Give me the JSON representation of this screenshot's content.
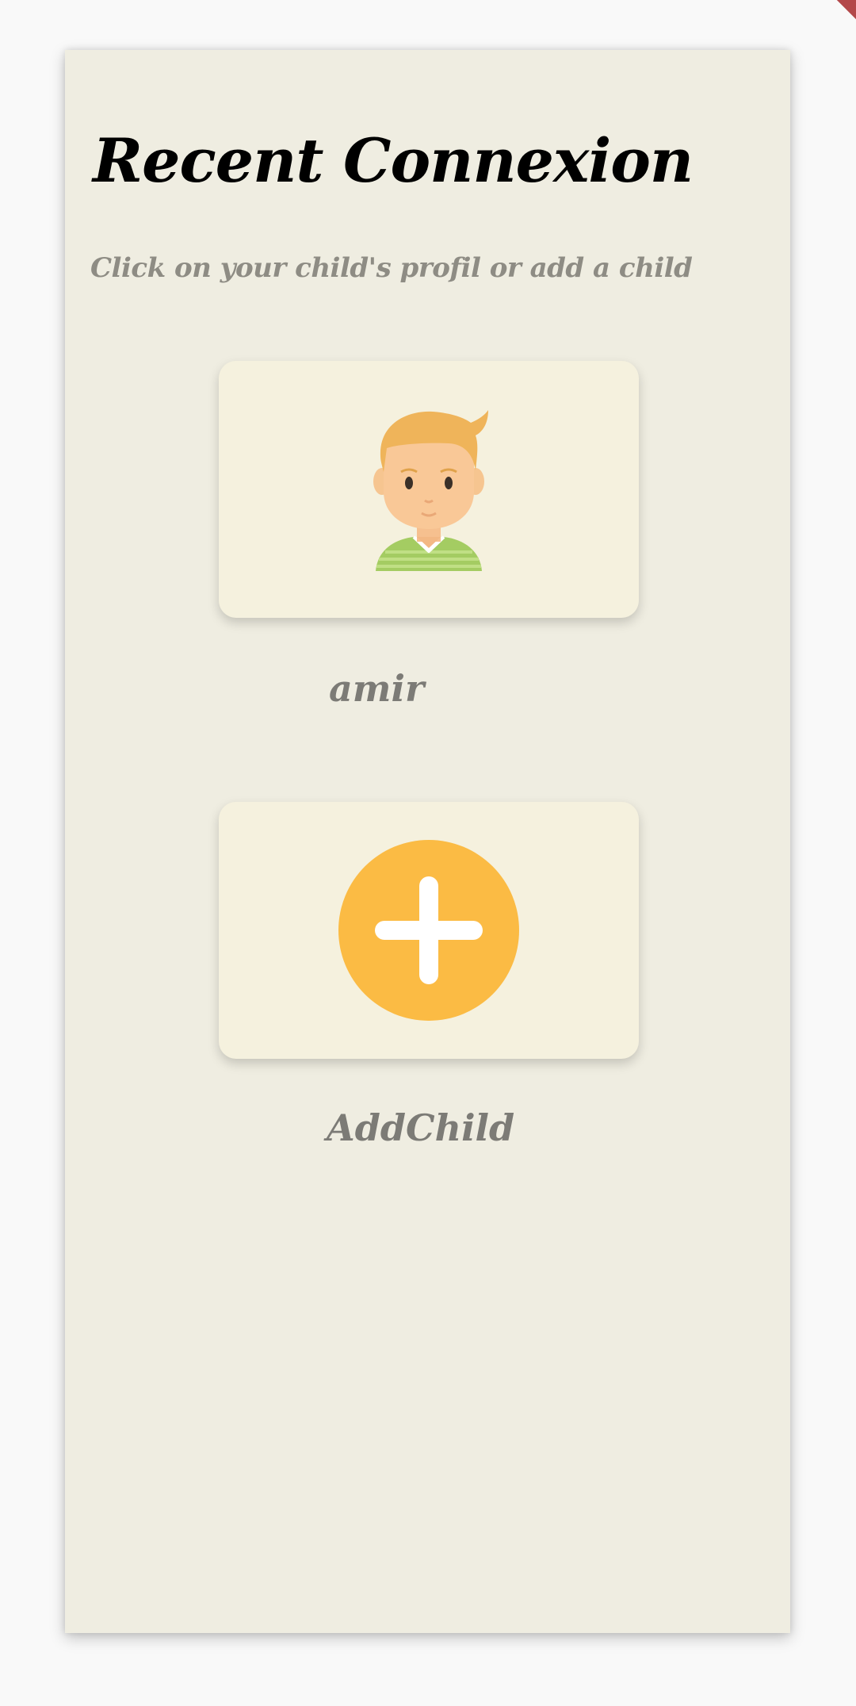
{
  "header": {
    "title": "Recent Connexion",
    "subtitle": "Click on your child's profil or add a child"
  },
  "profiles": [
    {
      "name": "amir",
      "icon": "boy-avatar-icon"
    }
  ],
  "add_child": {
    "label": "AddChild",
    "icon": "plus-circle-icon"
  },
  "colors": {
    "panel_background": "#efede1",
    "card_background": "#f5f1de",
    "plus_accent": "#fbbb44",
    "label_text": "#7c7b76",
    "subtitle_text": "#8e8c84"
  }
}
